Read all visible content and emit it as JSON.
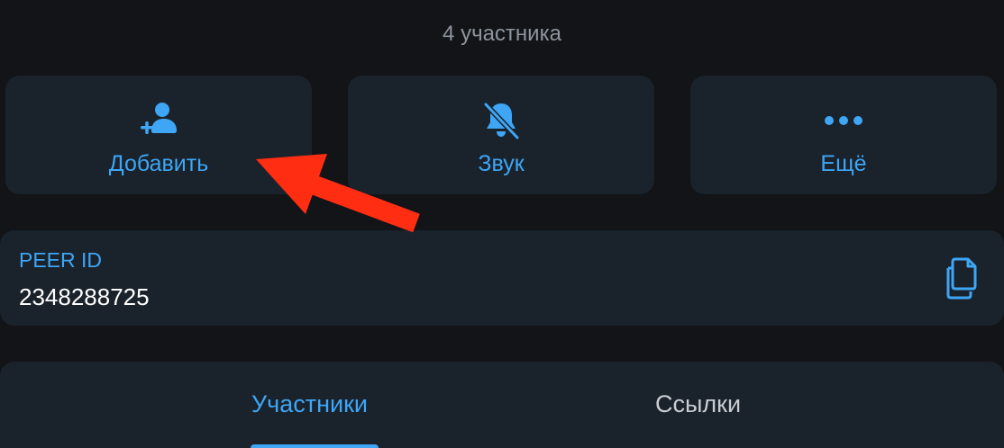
{
  "header": {
    "subtitle": "4 участника"
  },
  "actions": [
    {
      "label": "Добавить",
      "icon": "add-user-icon"
    },
    {
      "label": "Звук",
      "icon": "bell-muted-icon"
    },
    {
      "label": "Ещё",
      "icon": "more-dots-icon"
    }
  ],
  "peer": {
    "label": "PEER ID",
    "value": "2348288725",
    "copy_icon": "copy-icon"
  },
  "tabs": [
    {
      "label": "Участники",
      "active": true
    },
    {
      "label": "Ссылки",
      "active": false
    }
  ],
  "annotation": {
    "arrow_color": "#ff2d12"
  },
  "colors": {
    "accent": "#3ea6f5",
    "card": "#1a222c",
    "background": "#121418"
  }
}
